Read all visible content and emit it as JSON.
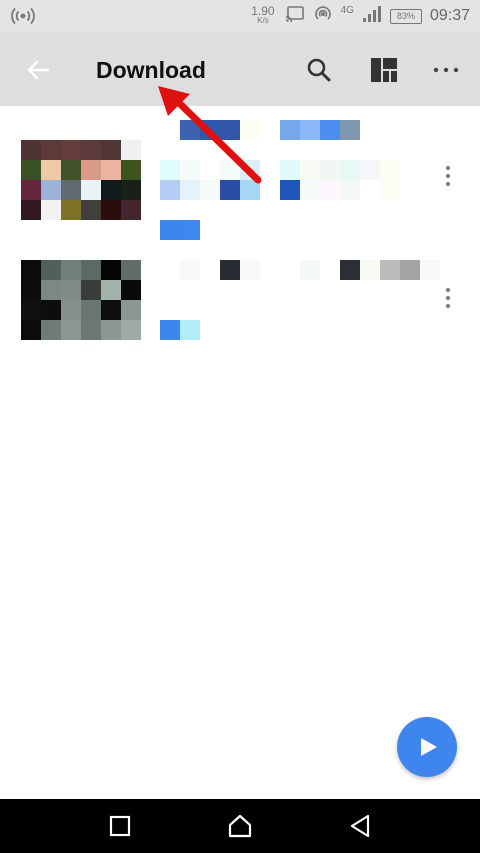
{
  "status_bar": {
    "speed_value": "1.90",
    "speed_unit": "K/s",
    "network_type": "4G",
    "battery_percent": "83%",
    "time": "09:37",
    "icons": [
      "hotspot-icon",
      "screen-cast-icon",
      "wifi-call-icon",
      "signal-icon",
      "battery-icon"
    ]
  },
  "toolbar": {
    "title": "Download",
    "back_icon": "arrow-left-icon",
    "search_icon": "search-icon",
    "layout_icon": "grid-layout-icon",
    "more_icon": "more-horizontal-icon"
  },
  "files": [
    {
      "name": "",
      "thumbnail": "pixelated-photo",
      "more_icon": "more-vertical-icon"
    },
    {
      "name": "",
      "thumbnail": "pixelated-photo",
      "more_icon": "more-vertical-icon"
    }
  ],
  "fab": {
    "icon": "play-icon",
    "color": "#3f85ee"
  },
  "annotation": {
    "color": "#e01010",
    "points_to": "toolbar-title"
  },
  "nav_bar": {
    "recent_icon": "square-recent-icon",
    "home_icon": "home-icon",
    "back_icon": "triangle-back-icon"
  }
}
